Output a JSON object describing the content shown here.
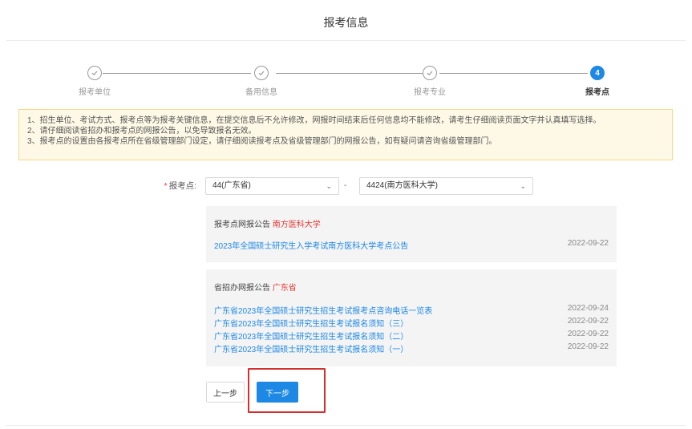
{
  "page": {
    "title": "报考信息"
  },
  "steps": [
    {
      "label": "报考单位",
      "state": "done",
      "icon": "check-icon"
    },
    {
      "label": "备用信息",
      "state": "done",
      "icon": "check-icon"
    },
    {
      "label": "报考专业",
      "state": "done",
      "icon": "check-icon"
    },
    {
      "label": "报考点",
      "state": "active",
      "number": "4"
    }
  ],
  "notice": {
    "lines": [
      "1、招生单位、考试方式、报考点等为报考关键信息，在提交信息后不允许修改，网报时间结束后任何信息均不能修改，请考生仔细阅读页面文字并认真填写选择。",
      "2、请仔细阅读省招办和报考点的网报公告，以免导致报名无效。",
      "3、报考点的设置由各报考点所在省级管理部门设定，请仔细阅读报考点及省级管理部门的网报公告，如有疑问请咨询省级管理部门。"
    ]
  },
  "form": {
    "required_mark": "*",
    "label": "报考点:",
    "province_select": "44(广东省)",
    "separator": "-",
    "site_select": "4424(南方医科大学)"
  },
  "site_announcements": {
    "title_prefix": "报考点网报公告",
    "title_highlight": "南方医科大学",
    "items": [
      {
        "title": "2023年全国硕士研究生入学考试南方医科大学考点公告",
        "date": "2022-09-22"
      }
    ]
  },
  "province_announcements": {
    "title_prefix": "省招办网报公告",
    "title_highlight": "广东省",
    "items": [
      {
        "title": "广东省2023年全国硕士研究生招生考试报考点咨询电话一览表",
        "date": "2022-09-24"
      },
      {
        "title": "广东省2023年全国硕士研究生招生考试报名须知（三）",
        "date": "2022-09-22"
      },
      {
        "title": "广东省2023年全国硕士研究生招生考试报名须知（二）",
        "date": "2022-09-22"
      },
      {
        "title": "广东省2023年全国硕士研究生招生考试报名须知（一）",
        "date": "2022-09-22"
      }
    ]
  },
  "buttons": {
    "prev": "上一步",
    "next": "下一步"
  },
  "colors": {
    "accent": "#1e88e5",
    "highlight_red": "#d32f2f",
    "notice_bg": "#fef9e6"
  }
}
